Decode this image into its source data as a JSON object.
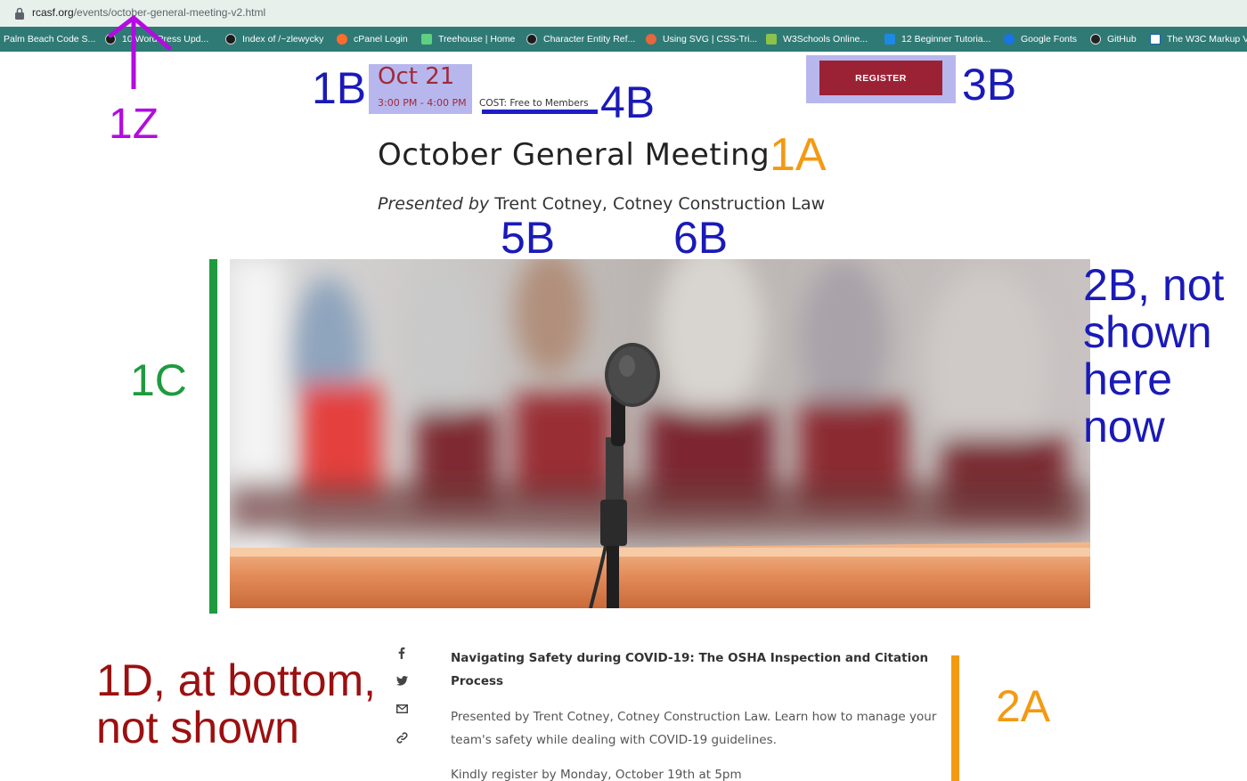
{
  "browser": {
    "url_host": "rcasf.org",
    "url_path": "/events/october-general-meeting-v2.html",
    "bookmarks": [
      {
        "label": "Palm Beach Code S...",
        "icon": "none"
      },
      {
        "label": "10 WordPress Upd...",
        "icon": "globe-icon"
      },
      {
        "label": "Index of /~zlewycky",
        "icon": "globe-icon"
      },
      {
        "label": "cPanel Login",
        "icon": "cpanel-icon"
      },
      {
        "label": "Treehouse | Home",
        "icon": "treehouse-icon"
      },
      {
        "label": "Character Entity Ref...",
        "icon": "globe-icon"
      },
      {
        "label": "Using SVG | CSS-Tri...",
        "icon": "css-tricks-icon"
      },
      {
        "label": "W3Schools Online...",
        "icon": "w3schools-icon"
      },
      {
        "label": "12 Beginner Tutoria...",
        "icon": "medium-icon"
      },
      {
        "label": "Google Fonts",
        "icon": "google-fonts-icon"
      },
      {
        "label": "GitHub",
        "icon": "github-icon"
      },
      {
        "label": "The W3C Markup V",
        "icon": "w3c-icon"
      }
    ]
  },
  "event": {
    "month_day": "Oct 21",
    "time": "3:00 PM - 4:00 PM",
    "cost": "COST: Free to Members",
    "register_label": "REGISTER",
    "title": "October General Meeting",
    "presented_by_label": "Presented by",
    "presenter": "Trent Cotney, Cotney Construction Law",
    "article_title": "Navigating Safety during COVID-19: The OSHA Inspection and Citation Process",
    "article_desc": "Presented by Trent Cotney, Cotney Construction Law. Learn how to manage your team's safety while dealing with COVID-19 guidelines.",
    "article_note": "Kindly register by Monday, October 19th at 5pm"
  },
  "share_icons": [
    "facebook-icon",
    "twitter-icon",
    "email-icon",
    "link-icon"
  ],
  "annotations": {
    "z1": "1Z",
    "a1": "1A",
    "b1": "1B",
    "b3": "3B",
    "b4": "4B",
    "b5": "5B",
    "b6": "6B",
    "c1": "1C",
    "b2_line1": "2B, not",
    "b2_line2": "shown",
    "b2_line3": "here",
    "b2_line4": "now",
    "d1_line1": "1D, at bottom,",
    "d1_line2": "not shown",
    "a2": "2A"
  },
  "colors": {
    "annotation_purple": "#b30be0",
    "annotation_orange": "#f39a12",
    "annotation_blue": "#1a1ab8",
    "annotation_green": "#1f9a3f",
    "annotation_red": "#9b1010",
    "highlight_lavender": "#b7b7ee",
    "brand_red": "#9b2235",
    "bookmark_bar": "#2f7a75"
  }
}
